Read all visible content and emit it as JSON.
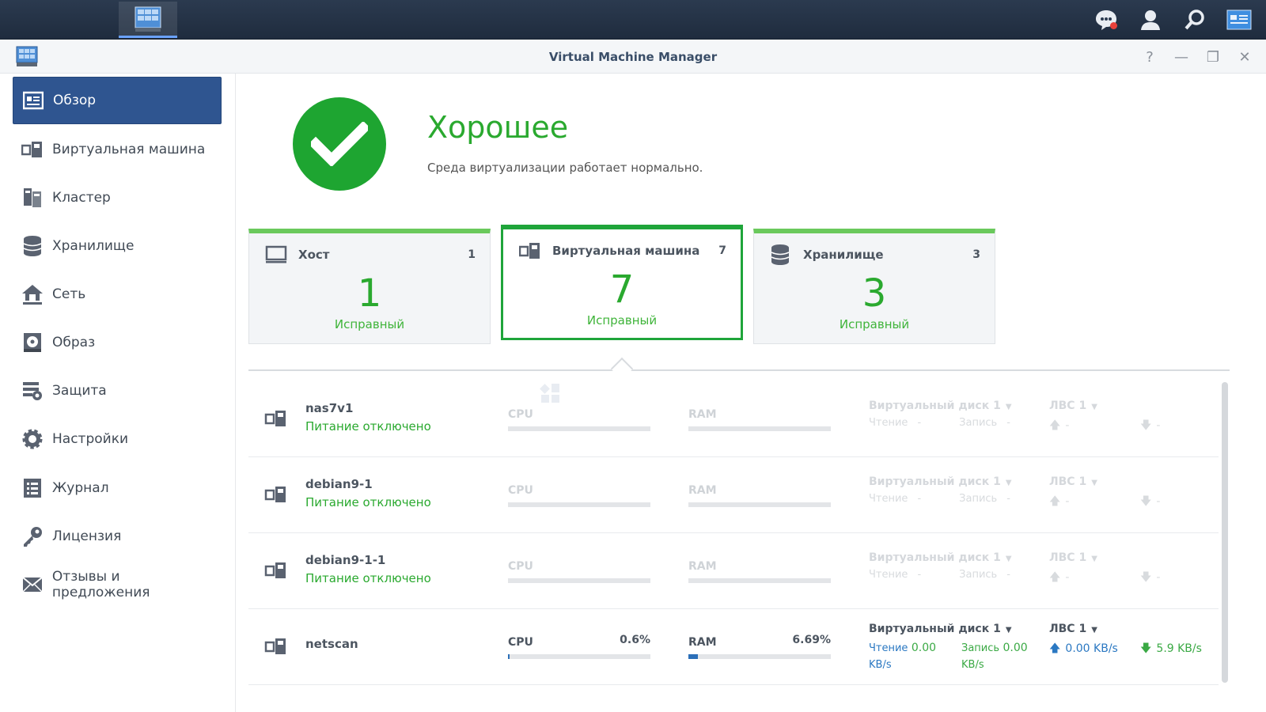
{
  "window": {
    "title": "Virtual Machine Manager"
  },
  "taskbar": {
    "icons": [
      "main-menu-icon",
      "vmm-app-icon",
      "chat-icon",
      "user-icon",
      "search-icon",
      "widgets-icon"
    ]
  },
  "sidebar": {
    "items": [
      {
        "label": "Обзор",
        "icon": "overview-icon",
        "active": true
      },
      {
        "label": "Виртуальная машина",
        "icon": "vm-icon"
      },
      {
        "label": "Кластер",
        "icon": "cluster-icon"
      },
      {
        "label": "Хранилище",
        "icon": "storage-icon"
      },
      {
        "label": "Сеть",
        "icon": "network-icon"
      },
      {
        "label": "Образ",
        "icon": "image-icon"
      },
      {
        "label": "Защита",
        "icon": "protection-icon"
      },
      {
        "label": "Настройки",
        "icon": "settings-icon"
      },
      {
        "label": "Журнал",
        "icon": "log-icon"
      },
      {
        "label": "Лицензия",
        "icon": "license-icon"
      },
      {
        "label": "Отзывы и предложения",
        "icon": "feedback-icon"
      }
    ]
  },
  "status": {
    "title": "Хорошее",
    "description": "Среда виртуализации работает нормально.",
    "color": "#1ea531"
  },
  "cards": [
    {
      "label": "Хост",
      "count": "1",
      "big": "1",
      "sub": "Исправный"
    },
    {
      "label": "Виртуальная машина",
      "count": "7",
      "big": "7",
      "sub": "Исправный"
    },
    {
      "label": "Хранилище",
      "count": "3",
      "big": "3",
      "sub": "Исправный"
    }
  ],
  "vms": [
    {
      "name": "nas7v1",
      "state": "Питание отключено",
      "cpu_label": "CPU",
      "ram_label": "RAM",
      "disk_label": "Виртуальный диск 1",
      "read_label": "Чтение",
      "read_val": "-",
      "write_label": "Запись",
      "write_val": "-",
      "net_label": "ЛВС 1",
      "up": "-",
      "down": "-"
    },
    {
      "name": "debian9-1",
      "state": "Питание отключено",
      "cpu_label": "CPU",
      "ram_label": "RAM",
      "disk_label": "Виртуальный диск 1",
      "read_label": "Чтение",
      "read_val": "-",
      "write_label": "Запись",
      "write_val": "-",
      "net_label": "ЛВС 1",
      "up": "-",
      "down": "-"
    },
    {
      "name": "debian9-1-1",
      "state": "Питание отключено",
      "cpu_label": "CPU",
      "ram_label": "RAM",
      "disk_label": "Виртуальный диск 1",
      "read_label": "Чтение",
      "read_val": "-",
      "write_label": "Запись",
      "write_val": "-",
      "net_label": "ЛВС 1",
      "up": "-",
      "down": "-"
    },
    {
      "name": "netscan",
      "state": "",
      "cpu_label": "CPU",
      "cpu_pct": "0.6%",
      "cpu_fill": 0.006,
      "ram_label": "RAM",
      "ram_pct": "6.69%",
      "ram_fill": 0.0669,
      "disk_label": "Виртуальный диск 1",
      "read_label": "Чтение",
      "read_val": "0.00",
      "read_unit": "KB/s",
      "write_label": "Запись",
      "write_val": "0.00",
      "write_unit": "KB/s",
      "net_label": "ЛВС 1",
      "up": "0.00 KB/s",
      "down": "5.9 KB/s"
    }
  ]
}
